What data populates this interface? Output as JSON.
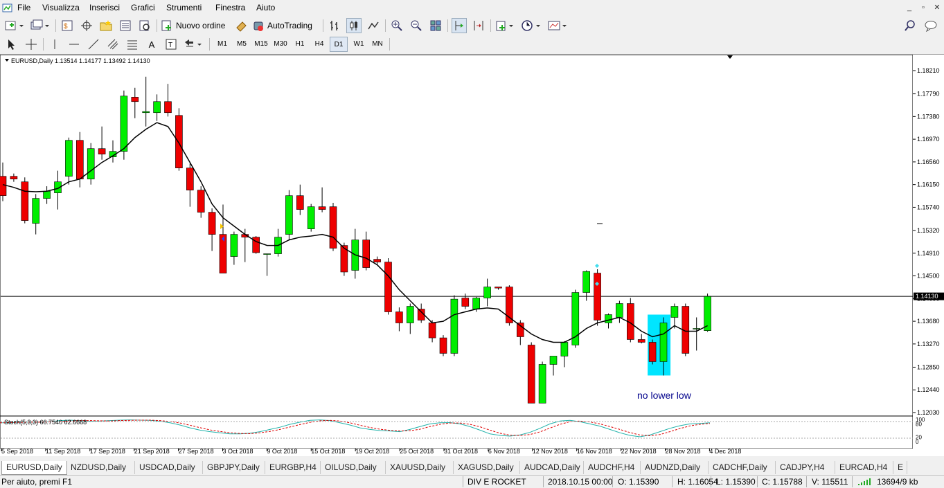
{
  "menu": [
    "File",
    "Visualizza",
    "Inserisci",
    "Grafici",
    "Strumenti",
    "Finestra",
    "Aiuto"
  ],
  "toolbar": {
    "new_order": "Nuovo ordine",
    "autotrading": "AutoTrading"
  },
  "timeframes": [
    "M1",
    "M5",
    "M15",
    "M30",
    "H1",
    "H4",
    "D1",
    "W1",
    "MN"
  ],
  "active_timeframe": "D1",
  "chart": {
    "header": "EURUSD,Daily  1.13514 1.14177 1.13492 1.14130",
    "current_price": "1.14130",
    "annotation": "no lower low",
    "indicator_label": "Stoch(5,3,3) 66.7540 62.6668"
  },
  "chart_data": {
    "type": "candlestick",
    "price_ticks": [
      "1.18210",
      "1.17790",
      "1.17380",
      "1.16970",
      "1.16560",
      "1.16150",
      "1.15740",
      "1.15320",
      "1.14910",
      "1.14500",
      "1.14090",
      "1.13680",
      "1.13270",
      "1.12850",
      "1.12440",
      "1.12030"
    ],
    "stoch_ticks": [
      "100",
      "80",
      "20",
      "0"
    ],
    "date_labels": [
      "5 Sep 2018",
      "11 Sep 2018",
      "17 Sep 2018",
      "21 Sep 2018",
      "27 Sep 2018",
      "3 Oct 2018",
      "9 Oct 2018",
      "15 Oct 2018",
      "19 Oct 2018",
      "25 Oct 2018",
      "31 Oct 2018",
      "6 Nov 2018",
      "12 Nov 2018",
      "16 Nov 2018",
      "22 Nov 2018",
      "28 Nov 2018",
      "4 Dec 2018"
    ],
    "candles": [
      [
        1.163,
        1.1655,
        1.1585,
        1.1595
      ],
      [
        1.163,
        1.1635,
        1.162,
        1.1625
      ],
      [
        1.162,
        1.1628,
        1.1545,
        1.155
      ],
      [
        1.1545,
        1.1598,
        1.1525,
        1.159
      ],
      [
        1.159,
        1.1612,
        1.158,
        1.1603
      ],
      [
        1.16,
        1.164,
        1.157,
        1.162
      ],
      [
        1.163,
        1.17,
        1.1615,
        1.1695
      ],
      [
        1.1695,
        1.171,
        1.161,
        1.1625
      ],
      [
        1.1625,
        1.169,
        1.1615,
        1.168
      ],
      [
        1.168,
        1.172,
        1.166,
        1.167
      ],
      [
        1.1665,
        1.1695,
        1.1655,
        1.1675
      ],
      [
        1.1675,
        1.1785,
        1.166,
        1.1775
      ],
      [
        1.1773,
        1.179,
        1.1735,
        1.1765
      ],
      [
        1.1745,
        1.181,
        1.172,
        1.1747
      ],
      [
        1.1745,
        1.1778,
        1.173,
        1.1765
      ],
      [
        1.1765,
        1.1797,
        1.1738,
        1.1745
      ],
      [
        1.174,
        1.1753,
        1.164,
        1.1645
      ],
      [
        1.1645,
        1.1653,
        1.1575,
        1.1605
      ],
      [
        1.1605,
        1.1612,
        1.1555,
        1.1565
      ],
      [
        1.1565,
        1.1572,
        1.1495,
        1.1525
      ],
      [
        1.1525,
        1.1579,
        1.149,
        1.1455
      ],
      [
        1.1485,
        1.153,
        1.147,
        1.1525
      ],
      [
        1.1525,
        1.1535,
        1.1475,
        1.152
      ],
      [
        1.152,
        1.1522,
        1.149,
        1.1492
      ],
      [
        1.149,
        1.149,
        1.145,
        1.149
      ],
      [
        1.149,
        1.1535,
        1.1485,
        1.152
      ],
      [
        1.1525,
        1.1605,
        1.1515,
        1.1595
      ],
      [
        1.1595,
        1.1615,
        1.156,
        1.157
      ],
      [
        1.1535,
        1.158,
        1.153,
        1.1575
      ],
      [
        1.1575,
        1.161,
        1.1565,
        1.157
      ],
      [
        1.1575,
        1.1582,
        1.1495,
        1.15
      ],
      [
        1.1505,
        1.151,
        1.145,
        1.1457
      ],
      [
        1.146,
        1.1535,
        1.1445,
        1.1515
      ],
      [
        1.1515,
        1.153,
        1.146,
        1.1465
      ],
      [
        1.148,
        1.1485,
        1.147,
        1.1475
      ],
      [
        1.1475,
        1.1482,
        1.138,
        1.1385
      ],
      [
        1.1385,
        1.1393,
        1.135,
        1.1365
      ],
      [
        1.1365,
        1.14,
        1.1345,
        1.1395
      ],
      [
        1.139,
        1.14,
        1.1365,
        1.137
      ],
      [
        1.1365,
        1.137,
        1.133,
        1.1338
      ],
      [
        1.1338,
        1.1343,
        1.1305,
        1.131
      ],
      [
        1.131,
        1.1415,
        1.1305,
        1.1408
      ],
      [
        1.141,
        1.1418,
        1.139,
        1.1395
      ],
      [
        1.139,
        1.1412,
        1.1385,
        1.141
      ],
      [
        1.141,
        1.1445,
        1.1395,
        1.143
      ],
      [
        1.143,
        1.143,
        1.1425,
        1.1428
      ],
      [
        1.143,
        1.1433,
        1.136,
        1.1365
      ],
      [
        1.1365,
        1.137,
        1.1325,
        1.134
      ],
      [
        1.1325,
        1.133,
        1.122,
        1.122
      ],
      [
        1.122,
        1.1295,
        1.122,
        1.129
      ],
      [
        1.129,
        1.1305,
        1.127,
        1.1305
      ],
      [
        1.1305,
        1.1332,
        1.1285,
        1.133
      ],
      [
        1.1325,
        1.1425,
        1.132,
        1.142
      ],
      [
        1.142,
        1.146,
        1.1405,
        1.1458
      ],
      [
        1.1455,
        1.1462,
        1.136,
        1.137
      ],
      [
        1.1365,
        1.1382,
        1.1355,
        1.138
      ],
      [
        1.1375,
        1.1405,
        1.1365,
        1.14
      ],
      [
        1.14,
        1.141,
        1.133,
        1.1335
      ],
      [
        1.1335,
        1.1345,
        1.1328,
        1.133
      ],
      [
        1.133,
        1.1335,
        1.129,
        1.1295
      ],
      [
        1.1295,
        1.1375,
        1.127,
        1.1365
      ],
      [
        1.1375,
        1.14,
        1.1355,
        1.1395
      ],
      [
        1.1395,
        1.14,
        1.1305,
        1.131
      ],
      [
        1.1355,
        1.1375,
        1.1315,
        1.1355
      ],
      [
        1.1351,
        1.1418,
        1.1349,
        1.1413
      ]
    ],
    "ma_values": [
      1.1615,
      1.161,
      1.1603,
      1.1602,
      1.1603,
      1.1608,
      1.162,
      1.1625,
      1.164,
      1.1655,
      1.1667,
      1.168,
      1.17,
      1.1715,
      1.1727,
      1.172,
      1.169,
      1.1655,
      1.162,
      1.158,
      1.1555,
      1.154,
      1.1525,
      1.1512,
      1.1505,
      1.1505,
      1.1515,
      1.152,
      1.1522,
      1.1525,
      1.152,
      1.15,
      1.1488,
      1.1482,
      1.147,
      1.145,
      1.1425,
      1.1405,
      1.1385,
      1.1365,
      1.1368,
      1.138,
      1.1385,
      1.139,
      1.1392,
      1.139,
      1.1375,
      1.136,
      1.1345,
      1.1335,
      1.133,
      1.133,
      1.134,
      1.1355,
      1.1365,
      1.137,
      1.1375,
      1.1365,
      1.135,
      1.134,
      1.1345,
      1.136,
      1.135,
      1.135,
      1.136
    ],
    "stoch_k": [
      85,
      85,
      88,
      88,
      88,
      90,
      95,
      97,
      94,
      92,
      93,
      95,
      97,
      98,
      97,
      96,
      92,
      85,
      75,
      62,
      52,
      45,
      40,
      35,
      35,
      38,
      45,
      55,
      65,
      78,
      88,
      96,
      98,
      95,
      85,
      75,
      62,
      55,
      50,
      48,
      45,
      55,
      68,
      80,
      85,
      86,
      80,
      68,
      52,
      35,
      28,
      25,
      30,
      42,
      60,
      80,
      93,
      96,
      90,
      80,
      70,
      55,
      40,
      28,
      22,
      30,
      45,
      60,
      72,
      80,
      82,
      85
    ],
    "stoch_d": [
      85,
      86,
      87,
      88,
      88,
      89,
      91,
      93,
      95,
      95,
      94,
      93,
      95,
      96,
      97,
      97,
      95,
      91,
      84,
      74,
      63,
      53,
      46,
      40,
      37,
      36,
      40,
      46,
      55,
      66,
      77,
      87,
      94,
      96,
      93,
      85,
      74,
      64,
      56,
      51,
      48,
      49,
      56,
      68,
      78,
      84,
      84,
      78,
      67,
      52,
      38,
      29,
      28,
      32,
      44,
      61,
      78,
      90,
      93,
      89,
      80,
      68,
      55,
      41,
      30,
      27,
      32,
      45,
      59,
      71,
      78,
      82
    ]
  },
  "tabs": [
    "EURUSD,Daily",
    "NZDUSD,Daily",
    "USDCAD,Daily",
    "GBPJPY,Daily",
    "EURGBP,H4",
    "OILUSD,Daily",
    "XAUUSD,Daily",
    "XAGUSD,Daily",
    "AUDCAD,Daily",
    "AUDCHF,H4",
    "AUDNZD,Daily",
    "CADCHF,Daily",
    "CADJPY,H4",
    "EURCAD,H4",
    "E"
  ],
  "status": {
    "help": "Per aiuto, premi F1",
    "profile": "DIV E ROCKET",
    "datetime": "2018.10.15 00:00",
    "open": "O: 1.15390",
    "high": "H: 1.16054",
    "low": "L: 1.15390",
    "close": "C: 1.15788",
    "volume": "V: 115511",
    "traffic": "13694/9 kb"
  },
  "colors": {
    "bull": "#00ee00",
    "bear": "#ee0000",
    "ma": "#000000",
    "stoch_k": "#20b2aa",
    "stoch_d": "#dd0000",
    "highlight": "#00e5ff",
    "annotation": "#00008b"
  }
}
